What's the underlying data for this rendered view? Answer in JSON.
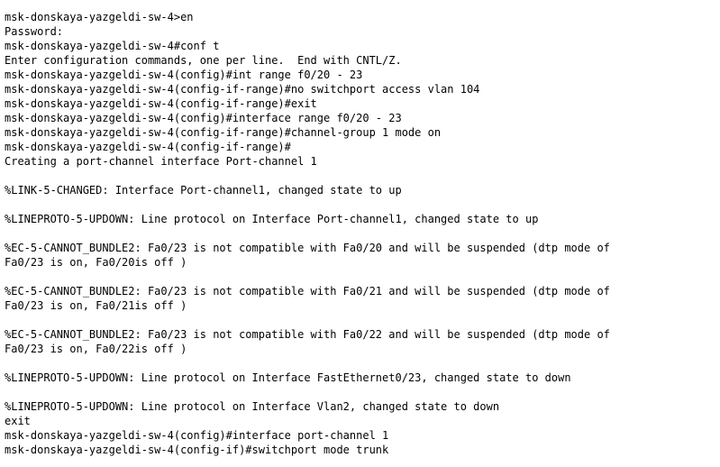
{
  "terminal": {
    "lines": [
      "msk-donskaya-yazgeldi-sw-4>en",
      "Password:",
      "msk-donskaya-yazgeldi-sw-4#conf t",
      "Enter configuration commands, one per line.  End with CNTL/Z.",
      "msk-donskaya-yazgeldi-sw-4(config)#int range f0/20 - 23",
      "msk-donskaya-yazgeldi-sw-4(config-if-range)#no switchport access vlan 104",
      "msk-donskaya-yazgeldi-sw-4(config-if-range)#exit",
      "msk-donskaya-yazgeldi-sw-4(config)#interface range f0/20 - 23",
      "msk-donskaya-yazgeldi-sw-4(config-if-range)#channel-group 1 mode on",
      "msk-donskaya-yazgeldi-sw-4(config-if-range)#",
      "Creating a port-channel interface Port-channel 1",
      "",
      "%LINK-5-CHANGED: Interface Port-channel1, changed state to up",
      "",
      "%LINEPROTO-5-UPDOWN: Line protocol on Interface Port-channel1, changed state to up",
      "",
      "%EC-5-CANNOT_BUNDLE2: Fa0/23 is not compatible with Fa0/20 and will be suspended (dtp mode of",
      "Fa0/23 is on, Fa0/20is off )",
      "",
      "%EC-5-CANNOT_BUNDLE2: Fa0/23 is not compatible with Fa0/21 and will be suspended (dtp mode of",
      "Fa0/23 is on, Fa0/21is off )",
      "",
      "%EC-5-CANNOT_BUNDLE2: Fa0/23 is not compatible with Fa0/22 and will be suspended (dtp mode of",
      "Fa0/23 is on, Fa0/22is off )",
      "",
      "%LINEPROTO-5-UPDOWN: Line protocol on Interface FastEthernet0/23, changed state to down",
      "",
      "%LINEPROTO-5-UPDOWN: Line protocol on Interface Vlan2, changed state to down",
      "exit",
      "msk-donskaya-yazgeldi-sw-4(config)#interface port-channel 1",
      "msk-donskaya-yazgeldi-sw-4(config-if)#switchport mode trunk"
    ],
    "background_color": "#ffffff",
    "text_color": "#000000"
  }
}
